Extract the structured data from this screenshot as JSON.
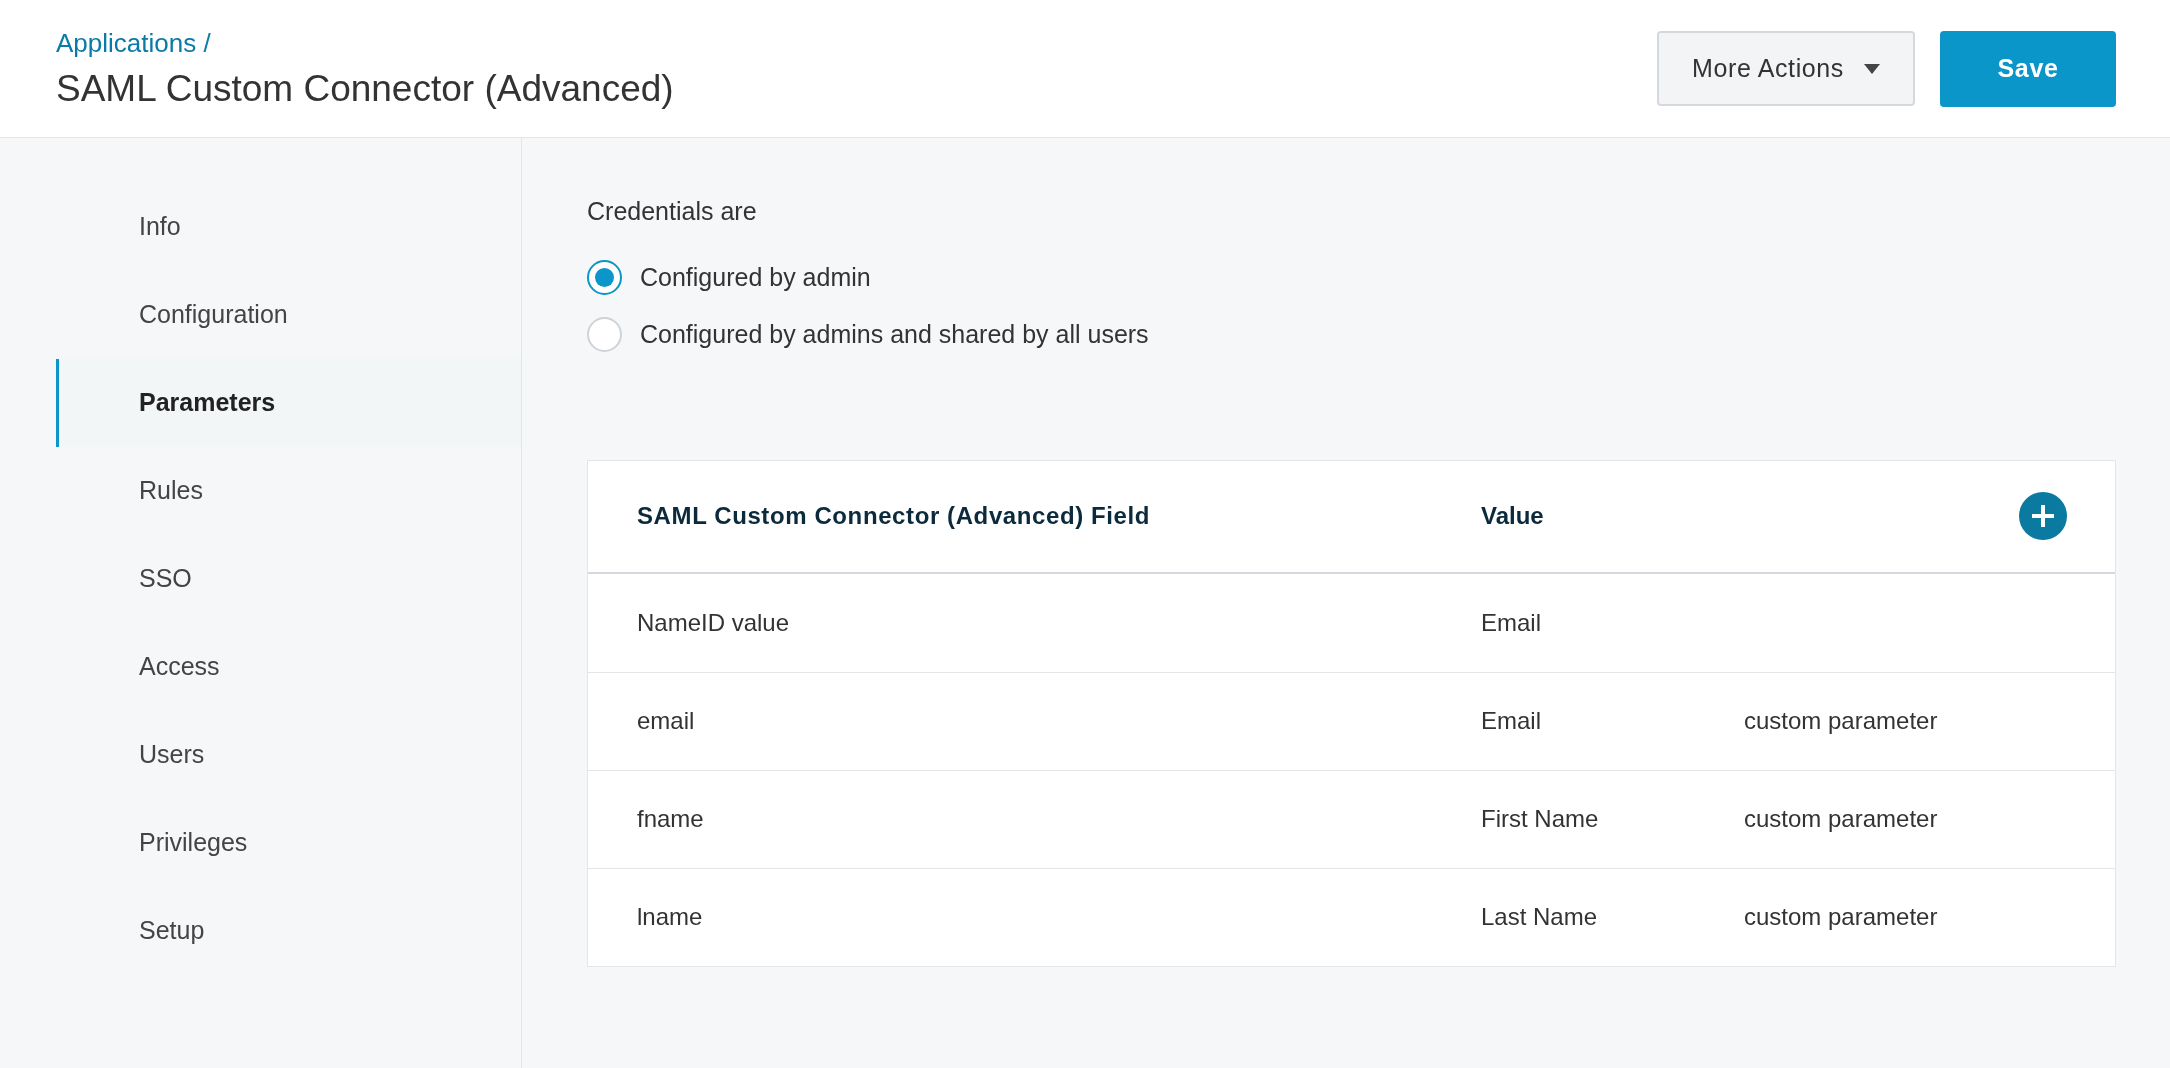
{
  "header": {
    "breadcrumb": "Applications /",
    "title": "SAML Custom Connector (Advanced)",
    "buttons": [
      {
        "label": "More Actions",
        "kind": "dropdown"
      },
      {
        "label": "Save",
        "kind": "primary"
      }
    ]
  },
  "sidebar": {
    "items": [
      {
        "label": "Info",
        "selected": false
      },
      {
        "label": "Configuration",
        "selected": false
      },
      {
        "label": "Parameters",
        "selected": true
      },
      {
        "label": "Rules",
        "selected": false
      },
      {
        "label": "SSO",
        "selected": false
      },
      {
        "label": "Access",
        "selected": false
      },
      {
        "label": "Users",
        "selected": false
      },
      {
        "label": "Privileges",
        "selected": false
      },
      {
        "label": "Setup",
        "selected": false
      }
    ]
  },
  "credentials": {
    "label": "Credentials are",
    "options": [
      {
        "label": "Configured by admin",
        "selected": true
      },
      {
        "label": "Configured by admins and shared by all users",
        "selected": false
      }
    ]
  },
  "table": {
    "columns": [
      "SAML Custom Connector (Advanced) Field",
      "Value"
    ],
    "rows": [
      {
        "field": "NameID value",
        "value": "Email"
      },
      {
        "field": "email",
        "value": "Email",
        "note": "custom parameter"
      },
      {
        "field": "fname",
        "value": "First Name",
        "note": "custom parameter"
      },
      {
        "field": "lname",
        "value": "Last Name",
        "note": "custom parameter"
      }
    ]
  }
}
